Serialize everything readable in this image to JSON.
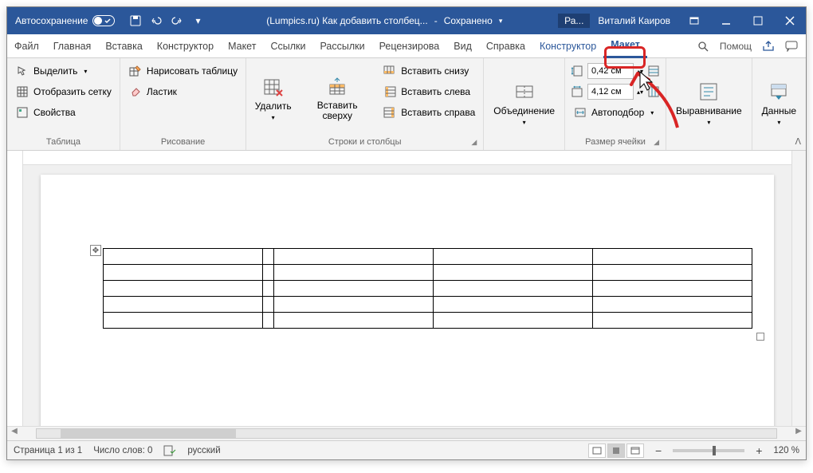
{
  "titlebar": {
    "autosave": "Автосохранение",
    "doc_title": "(Lumpics.ru) Как добавить столбец...",
    "saved": "Сохранено",
    "badge": "Ра...",
    "user": "Виталий Каиров"
  },
  "tabs": {
    "file": "Файл",
    "home": "Главная",
    "insert": "Вставка",
    "design": "Конструктор",
    "layout": "Макет",
    "references": "Ссылки",
    "mailings": "Рассылки",
    "review": "Рецензирова",
    "view": "Вид",
    "help": "Справка",
    "table_design": "Конструктор",
    "table_layout": "Макет",
    "assist": "Помощ"
  },
  "ribbon": {
    "table_group": {
      "select": "Выделить",
      "gridlines": "Отобразить сетку",
      "properties": "Свойства",
      "label": "Таблица"
    },
    "draw_group": {
      "draw": "Нарисовать таблицу",
      "eraser": "Ластик",
      "label": "Рисование"
    },
    "rowscols_group": {
      "delete": "Удалить",
      "insert_above": "Вставить сверху",
      "insert_below": "Вставить снизу",
      "insert_left": "Вставить слева",
      "insert_right": "Вставить справа",
      "label": "Строки и столбцы"
    },
    "merge_group": {
      "merge": "Объединение",
      "label": ""
    },
    "cellsize_group": {
      "height": "0,42 см",
      "width": "4,12 см",
      "autofit": "Автоподбор",
      "label": "Размер ячейки"
    },
    "align_group": {
      "alignment": "Выравнивание",
      "label": ""
    },
    "data_group": {
      "data": "Данные",
      "label": ""
    }
  },
  "statusbar": {
    "page": "Страница 1 из 1",
    "words": "Число слов: 0",
    "lang": "русский",
    "zoom": "120 %"
  }
}
